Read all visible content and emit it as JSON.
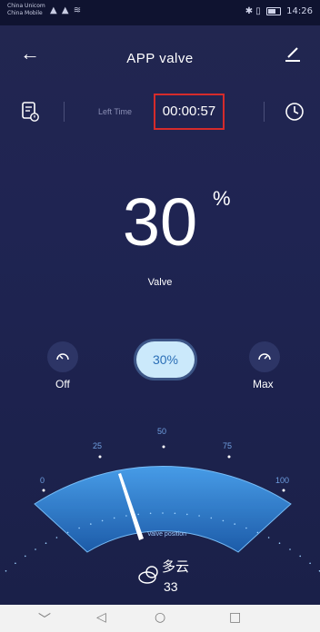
{
  "status": {
    "carrier_1": "China Unicom",
    "carrier_2": "China Mobile",
    "time": "14:26"
  },
  "header": {
    "back_icon": "arrow-left-icon",
    "title": "APP  valve",
    "edit_icon": "edit-pen-icon"
  },
  "timer": {
    "timer_icon": "schedule-icon",
    "left_time_label": "Left Time",
    "left_time_value": "00:00:57",
    "clock_icon": "clock-icon",
    "highlight_color": "#d52b2b"
  },
  "valve": {
    "value": "30",
    "unit": "%",
    "label": "Valve"
  },
  "controls": {
    "off_label": "Off",
    "max_label": "Max",
    "current_label": "30%"
  },
  "gauge": {
    "tick_labels": [
      "0",
      "25",
      "50",
      "75",
      "100"
    ],
    "needle_value": 30,
    "caption": "Valve position"
  },
  "weather": {
    "icon": "cloud-icon",
    "description": "多云",
    "temperature": "33"
  },
  "nav": {
    "items": [
      "﹀",
      "◁",
      "○",
      "□"
    ]
  },
  "colors": {
    "background": "#1f2452",
    "accent": "#3a8ee6",
    "pill_bg": "#cbe9fb"
  }
}
